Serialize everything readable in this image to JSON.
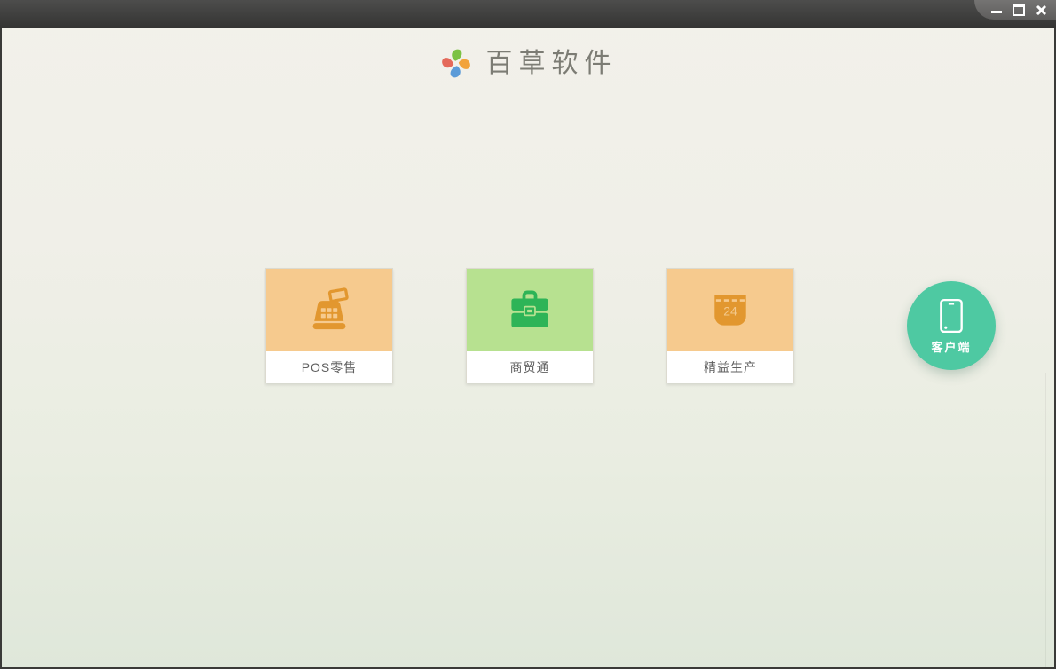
{
  "window": {
    "titlebar": {
      "buttons": [
        {
          "name": "minimize"
        },
        {
          "name": "maximize"
        },
        {
          "name": "close"
        }
      ],
      "bar_color": "#3f3f3e"
    }
  },
  "header": {
    "app_name": "百草软件",
    "logo": {
      "icon": "pinwheel-logo-icon",
      "petal_colors": {
        "top": "#7cc244",
        "right": "#f2a33c",
        "bottom": "#5b9bd8",
        "left": "#e4695a"
      }
    }
  },
  "products": [
    {
      "label": "POS零售",
      "icon": "cash-register-icon",
      "tile_bg": "#f6ca8e",
      "icon_color": "#e2972f"
    },
    {
      "label": "商贸通",
      "icon": "briefcase-icon",
      "tile_bg": "#b7e190",
      "icon_color": "#2eb457"
    },
    {
      "label": "精益生产",
      "icon": "calendar-icon",
      "calendar_day": "24",
      "tile_bg": "#f6ca8e",
      "icon_color": "#e2972f"
    }
  ],
  "client_badge": {
    "label": "客户端",
    "icon": "smartphone-icon",
    "bg": "#4ec9a2"
  },
  "colors": {
    "background_top": "#f2f1ea",
    "background_bottom": "#dfe7da"
  }
}
